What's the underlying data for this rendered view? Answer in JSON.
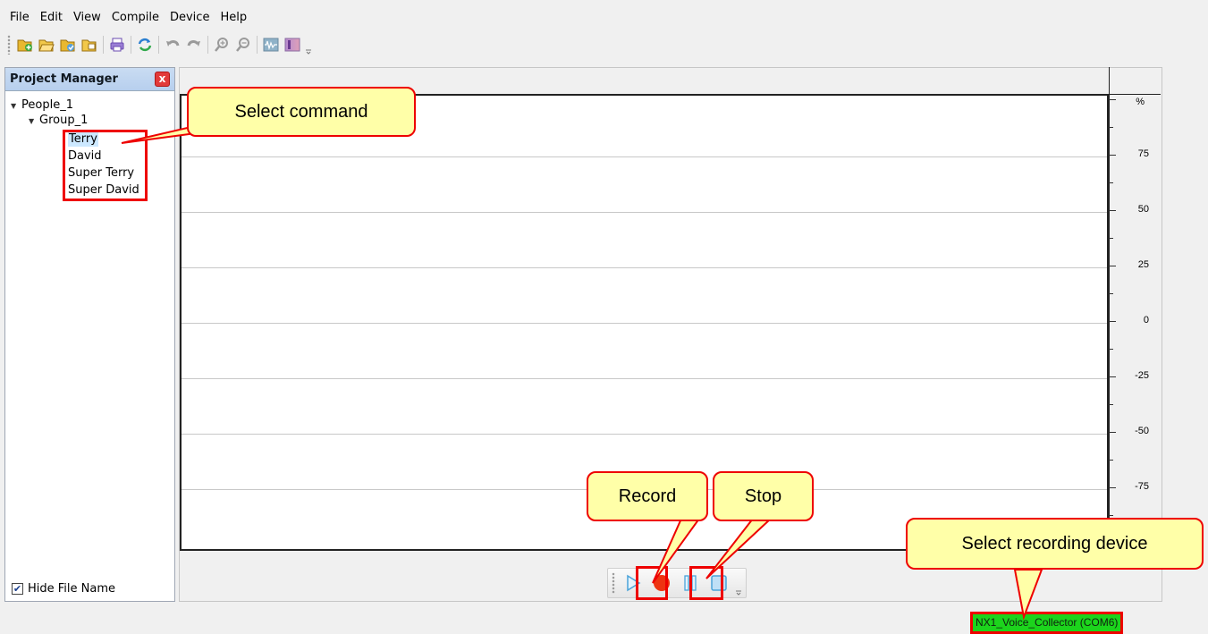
{
  "menu": [
    "File",
    "Edit",
    "View",
    "Compile",
    "Device",
    "Help"
  ],
  "toolbar": {
    "icons": [
      "new-project-icon",
      "open-folder-icon",
      "save-project-icon",
      "save-as-icon",
      "print-icon",
      "refresh-icon",
      "undo-icon",
      "redo-icon",
      "zoom-in-icon",
      "zoom-out-icon",
      "waveform-icon",
      "spectrum-icon"
    ]
  },
  "project_manager": {
    "title": "Project Manager",
    "close_label": "x",
    "tree": {
      "root": "People_1",
      "group": "Group_1",
      "items": [
        "Terry",
        "David",
        "Super Terry",
        "Super David"
      ],
      "selected": "Terry"
    },
    "hide_file_name": "Hide File Name",
    "hide_file_name_checked": true
  },
  "chart_data": {
    "type": "line",
    "ylabel": "%",
    "yticks": [
      75,
      50,
      25,
      0,
      -25,
      -50,
      -75
    ],
    "ylim": [
      -100,
      100
    ],
    "grid": true,
    "series": []
  },
  "playback": {
    "buttons": [
      "play-icon",
      "record-icon",
      "pause-icon",
      "stop-icon"
    ]
  },
  "status": {
    "device": "NX1_Voice_Collector (COM6)"
  },
  "annotations": {
    "select_command": "Select command",
    "record": "Record",
    "stop": "Stop",
    "select_device": "Select recording device"
  },
  "colors": {
    "annotation_red": "#ee0000",
    "callout_fill": "#ffffa8",
    "status_green": "#1cd41c",
    "record_red": "#ee3311",
    "selected_item_bg": "#cce8ff"
  }
}
